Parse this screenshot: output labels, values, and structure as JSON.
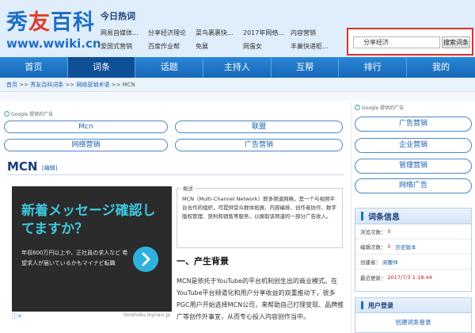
{
  "logo": {
    "name_part1": "秀",
    "name_part2": "友",
    "name_part3": "百科",
    "url": "www.wwiki.cn"
  },
  "hot": {
    "title": "今日热词",
    "rows": [
      [
        "网易自媒体...",
        "分享经济理论",
        "菜鸟裹裹快...",
        "2017年网络...",
        "内容营销"
      ],
      [
        "爱国式营销",
        "百度作业帮",
        "免展",
        "网蛋女",
        "丰巢快递柜..."
      ]
    ]
  },
  "search": {
    "value": "分享经济",
    "button": "搜索词条"
  },
  "nav": {
    "items": [
      "首页",
      "词条",
      "话题",
      "主持人",
      "互帮",
      "排行",
      "我的"
    ],
    "active_index": 1
  },
  "breadcrumb": {
    "home": "首页",
    "sep": ">>",
    "site": "秀友百科词条",
    "cat": "网络营销术语",
    "current": "MCN"
  },
  "ads": {
    "label": "Google 提供的广告"
  },
  "main": {
    "pills_row1": [
      "Mcn",
      "联盟"
    ],
    "pills_row2": [
      "网络营销",
      "广告营销"
    ],
    "title": "MCN",
    "edit": "[编辑]",
    "ad": {
      "headline": "新着メッセージ確認してますか？",
      "sub": "年収600万円以上や、正社員の求人など 希望求人が届いているかもマイナビ転職",
      "x_label": "ⓘ✕",
      "url": "tenshoku.mynavi.jp"
    },
    "summary_label": "概述",
    "summary": "MCN（Multi-Channel Network）即多频道网络，是一个与视频平台合作的组织，可提供受众群体拓展、内容编排、创作者协作、数字版权管理、获利和销售等服务，以换取该频道的一部分广告收入。",
    "section_title": "一、产生背景",
    "section_body": "MCN是依托于YouTube的平台机制创生出的商业模式。在YouTube平台频道化和用户分享收益的双重推动下，很多PGC用户开始选择MCN公司，来帮助自己打理变现、品牌推广等创作外事宜，从而专心投入内容创作当中。"
  },
  "sidebar": {
    "pills": [
      "广告营销",
      "企业营销",
      "管理营销",
      "网络广告"
    ],
    "info": {
      "title": "词条信息",
      "views_label": "浏览次数：",
      "views": "0",
      "edits_label": "编辑次数：",
      "edits": "0",
      "history": "历史版本",
      "creator_label": "创建者：",
      "creator": "阅蕾帅",
      "updated_label": "最近更新：",
      "updated": "2017/7/3 1:18:44"
    },
    "login": {
      "title": "用户登录",
      "link": "创建词条登录"
    }
  }
}
